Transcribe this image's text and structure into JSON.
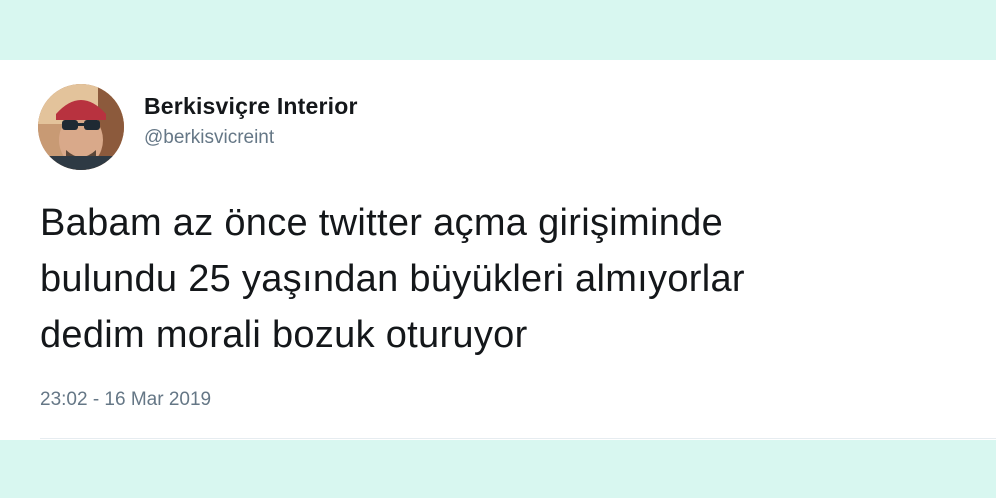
{
  "tweet": {
    "author": {
      "display_name": "Berkisviçre Interior",
      "handle": "@berkisvicreint",
      "avatar_icon": "user-avatar-photo"
    },
    "text": "Babam az önce twitter açma girişiminde\nbulundu 25 yaşından büyükleri almıyorlar\ndedim morali bozuk oturuyor",
    "timestamp": "23:02 - 16 Mar 2019"
  },
  "colors": {
    "background": "#d8f7f0",
    "card": "#ffffff",
    "text_primary": "#14171a",
    "text_secondary": "#657786"
  }
}
